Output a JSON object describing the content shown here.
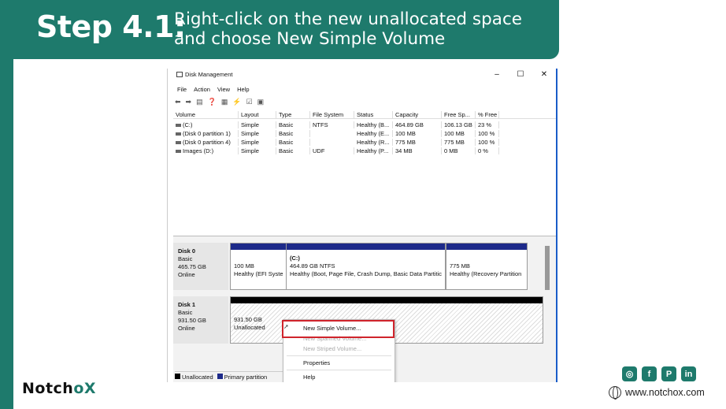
{
  "header": {
    "step": "Step 4.1:",
    "desc_line1": "Right-click on the new unallocated space",
    "desc_line2": "and choose New Simple Volume"
  },
  "brand": {
    "name_a": "Notch",
    "name_b": "o",
    "name_c": "X"
  },
  "social": [
    "instagram-icon",
    "facebook-icon",
    "pinterest-icon",
    "linkedin-icon"
  ],
  "website": "www.notchox.com",
  "window": {
    "title": "Disk Management",
    "controls": [
      "–",
      "☐",
      "✕"
    ],
    "menu": [
      "File",
      "Action",
      "View",
      "Help"
    ],
    "columns": [
      "Volume",
      "Layout",
      "Type",
      "File System",
      "Status",
      "Capacity",
      "Free Sp...",
      "% Free"
    ],
    "rows": [
      [
        "(C:)",
        "Simple",
        "Basic",
        "NTFS",
        "Healthy (B...",
        "464.89 GB",
        "106.13 GB",
        "23 %"
      ],
      [
        "(Disk 0 partition 1)",
        "Simple",
        "Basic",
        "",
        "Healthy (E...",
        "100 MB",
        "100 MB",
        "100 %"
      ],
      [
        "(Disk 0 partition 4)",
        "Simple",
        "Basic",
        "",
        "Healthy (R...",
        "775 MB",
        "775 MB",
        "100 %"
      ],
      [
        "Images (D:)",
        "Simple",
        "Basic",
        "UDF",
        "Healthy (P...",
        "34 MB",
        "0 MB",
        "0 %"
      ]
    ],
    "disk0": {
      "name": "Disk 0",
      "type": "Basic",
      "size": "465.75 GB",
      "status": "Online",
      "p1": {
        "size": "100 MB",
        "status": "Healthy (EFI Syste"
      },
      "p2": {
        "label": "(C:)",
        "size": "464.89 GB NTFS",
        "status": "Healthy (Boot, Page File, Crash Dump, Basic Data Partitic"
      },
      "p3": {
        "size": "775 MB",
        "status": "Healthy (Recovery Partition"
      }
    },
    "disk1": {
      "name": "Disk 1",
      "type": "Basic",
      "size": "931.50 GB",
      "status": "Online",
      "p1": {
        "size": "931.50 GB",
        "status": "Unallocated"
      }
    },
    "legend": {
      "unallocated": "Unallocated",
      "primary": "Primary partition"
    },
    "context_menu": {
      "new_simple": "New Simple Volume...",
      "new_spanned": "New Spanned Volume...",
      "new_striped": "New Striped Volume...",
      "properties": "Properties",
      "help": "Help"
    }
  }
}
